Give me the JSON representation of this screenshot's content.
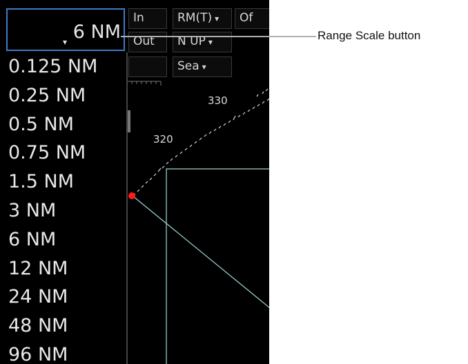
{
  "header": {
    "range_value": "6 NM",
    "btn_in": "In",
    "btn_out": "Out",
    "btn_motion": "RM(T)",
    "btn_orientation": "N UP",
    "btn_off": "Of",
    "btn_sea": "Sea"
  },
  "range_options": [
    "0.125 NM",
    "0.25 NM",
    "0.5 NM",
    "0.75 NM",
    "1.5 NM",
    "3 NM",
    "6 NM",
    "12 NM",
    "24 NM",
    "48 NM",
    "96 NM"
  ],
  "bearing_labels": {
    "b320": "320",
    "b330": "330"
  },
  "callout": {
    "label": "Range Scale button"
  },
  "colors": {
    "highlight_border": "#3f7dc4",
    "own_ship": "#ff1a1a",
    "line": "#9fd8d8"
  }
}
